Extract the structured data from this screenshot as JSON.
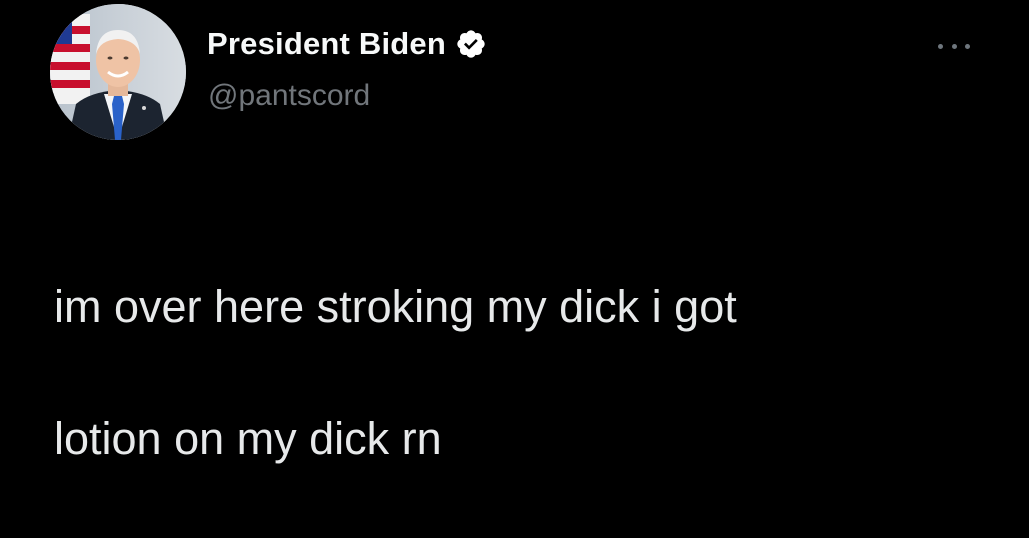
{
  "tweet": {
    "display_name": "President Biden",
    "handle": "@pantscord",
    "verified": true,
    "avatar_icon": "profile-photo",
    "more_icon": "more-options-icon",
    "text_line_1": "im over here stroking my dick i got",
    "text_line_2": "lotion on my dick rn"
  },
  "colors": {
    "background": "#000000",
    "name": "#f7f9f9",
    "handle": "#71767b",
    "body_text": "#e7e9ea",
    "verified_badge": "#ffffff"
  }
}
